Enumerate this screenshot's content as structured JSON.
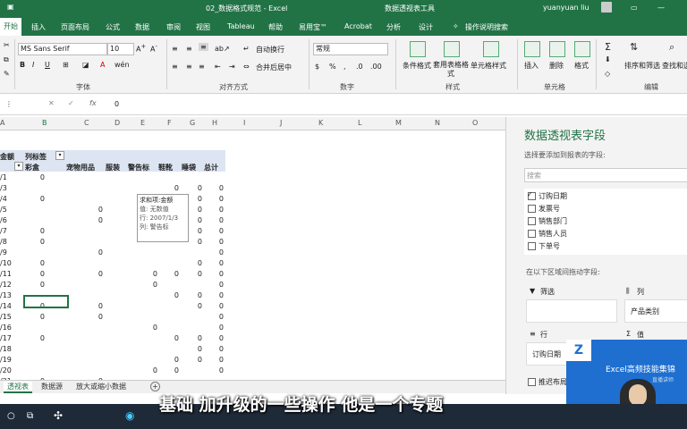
{
  "titlebar": {
    "filename": "02_数据格式规范 - Excel",
    "context_tab": "数据透视表工具",
    "user": "yuanyuan liu"
  },
  "tabs": [
    "开始",
    "插入",
    "页面布局",
    "公式",
    "数据",
    "审阅",
    "视图",
    "Tableau",
    "帮助",
    "易用宝™",
    "Acrobat",
    "分析",
    "设计",
    "操作说明搜索"
  ],
  "ribbon": {
    "font_name": "MS Sans Serif",
    "font_size": "10",
    "wrap_text": "自动换行",
    "merge_center": "合并后居中",
    "number_format": "常规",
    "cond_format": "条件格式",
    "table_format": "套用表格格式",
    "cell_style": "单元格样式",
    "insert": "插入",
    "delete": "删除",
    "format": "格式",
    "sort_filter": "排序和筛选",
    "find_select": "查找和选",
    "groups": {
      "font": "字体",
      "align": "对齐方式",
      "number": "数字",
      "styles": "样式",
      "cells": "单元格",
      "edit": "编辑"
    }
  },
  "formula_bar": {
    "fx": "fx",
    "value": "0"
  },
  "columns": [
    "A",
    "B",
    "C",
    "D",
    "E",
    "F",
    "G",
    "H",
    "I",
    "J",
    "K",
    "L",
    "M",
    "N",
    "O"
  ],
  "pivot": {
    "corner_label": "金额",
    "col_label": "列标签",
    "headers": [
      "彩盒",
      "宠物用品",
      "服装",
      "警告标",
      "鞋靴",
      "睡袋",
      "总计"
    ],
    "rows": [
      {
        "label": "/1",
        "vals": [
          "0",
          "",
          "",
          "",
          "",
          "",
          ""
        ]
      },
      {
        "label": "/3",
        "vals": [
          "",
          "",
          "",
          "",
          "0",
          "0",
          "0"
        ]
      },
      {
        "label": "/4",
        "vals": [
          "0",
          "",
          "",
          "",
          "0",
          "0",
          "0"
        ]
      },
      {
        "label": "/5",
        "vals": [
          "",
          "0",
          "",
          "",
          "",
          "0",
          "0"
        ]
      },
      {
        "label": "/6",
        "vals": [
          "",
          "0",
          "",
          "",
          "",
          "0",
          "0"
        ]
      },
      {
        "label": "/7",
        "vals": [
          "0",
          "",
          "",
          "",
          "",
          "0",
          "0"
        ]
      },
      {
        "label": "/8",
        "vals": [
          "0",
          "",
          "",
          "",
          "",
          "0",
          "0"
        ]
      },
      {
        "label": "/9",
        "vals": [
          "",
          "0",
          "",
          "",
          "",
          "",
          "0"
        ]
      },
      {
        "label": "/10",
        "vals": [
          "0",
          "",
          "",
          "",
          "",
          "0",
          "0"
        ]
      },
      {
        "label": "/11",
        "vals": [
          "0",
          "0",
          "",
          "0",
          "0",
          "0",
          "0"
        ]
      },
      {
        "label": "/12",
        "vals": [
          "0",
          "",
          "",
          "0",
          "",
          "",
          "0"
        ]
      },
      {
        "label": "/13",
        "vals": [
          "",
          "",
          "",
          "",
          "0",
          "0",
          "0"
        ]
      },
      {
        "label": "/14",
        "vals": [
          "0",
          "0",
          "",
          "",
          "",
          "0",
          "0"
        ]
      },
      {
        "label": "/15",
        "vals": [
          "0",
          "0",
          "",
          "",
          "",
          "",
          "0"
        ]
      },
      {
        "label": "/16",
        "vals": [
          "",
          "",
          "",
          "0",
          "",
          "",
          "0"
        ]
      },
      {
        "label": "/17",
        "vals": [
          "0",
          "",
          "",
          "",
          "0",
          "0",
          "0"
        ]
      },
      {
        "label": "/18",
        "vals": [
          "",
          "",
          "",
          "",
          "",
          "0",
          "0"
        ]
      },
      {
        "label": "/19",
        "vals": [
          "",
          "",
          "",
          "",
          "0",
          "0",
          "0"
        ]
      },
      {
        "label": "/20",
        "vals": [
          "",
          "",
          "",
          "0",
          "0",
          "",
          "0"
        ]
      },
      {
        "label": "/21",
        "vals": [
          "0",
          "0",
          "",
          "",
          "",
          "",
          ""
        ]
      }
    ]
  },
  "tooltip": {
    "line1": "求和项:金额",
    "line2": "值: 无数值",
    "line3": "行: 2007/1/3",
    "line4": "列: 警告标"
  },
  "sheet_tabs": [
    "透视表",
    "数据源",
    "放大或缩小数据"
  ],
  "pane": {
    "title": "数据透视表字段",
    "subtitle": "选择要添加到报表的字段:",
    "search_placeholder": "搜索",
    "fields": [
      {
        "name": "订购日期",
        "checked": true
      },
      {
        "name": "发票号",
        "checked": false
      },
      {
        "name": "销售部门",
        "checked": false
      },
      {
        "name": "销售人员",
        "checked": false
      },
      {
        "name": "下单号",
        "checked": false
      }
    ],
    "drag_hint": "在以下区域间拖动字段:",
    "filter_label": "筛选",
    "columns_label": "列",
    "column_item": "产品类别",
    "rows_label": "行",
    "row_item": "订购日期",
    "values_label": "值",
    "defer_label": "推迟布局更新"
  },
  "subtitle": "基础 加升级的一些操作 他是一个专题",
  "overlay": {
    "title": "Excel高频技能集锦",
    "sub": "直播讲师"
  }
}
